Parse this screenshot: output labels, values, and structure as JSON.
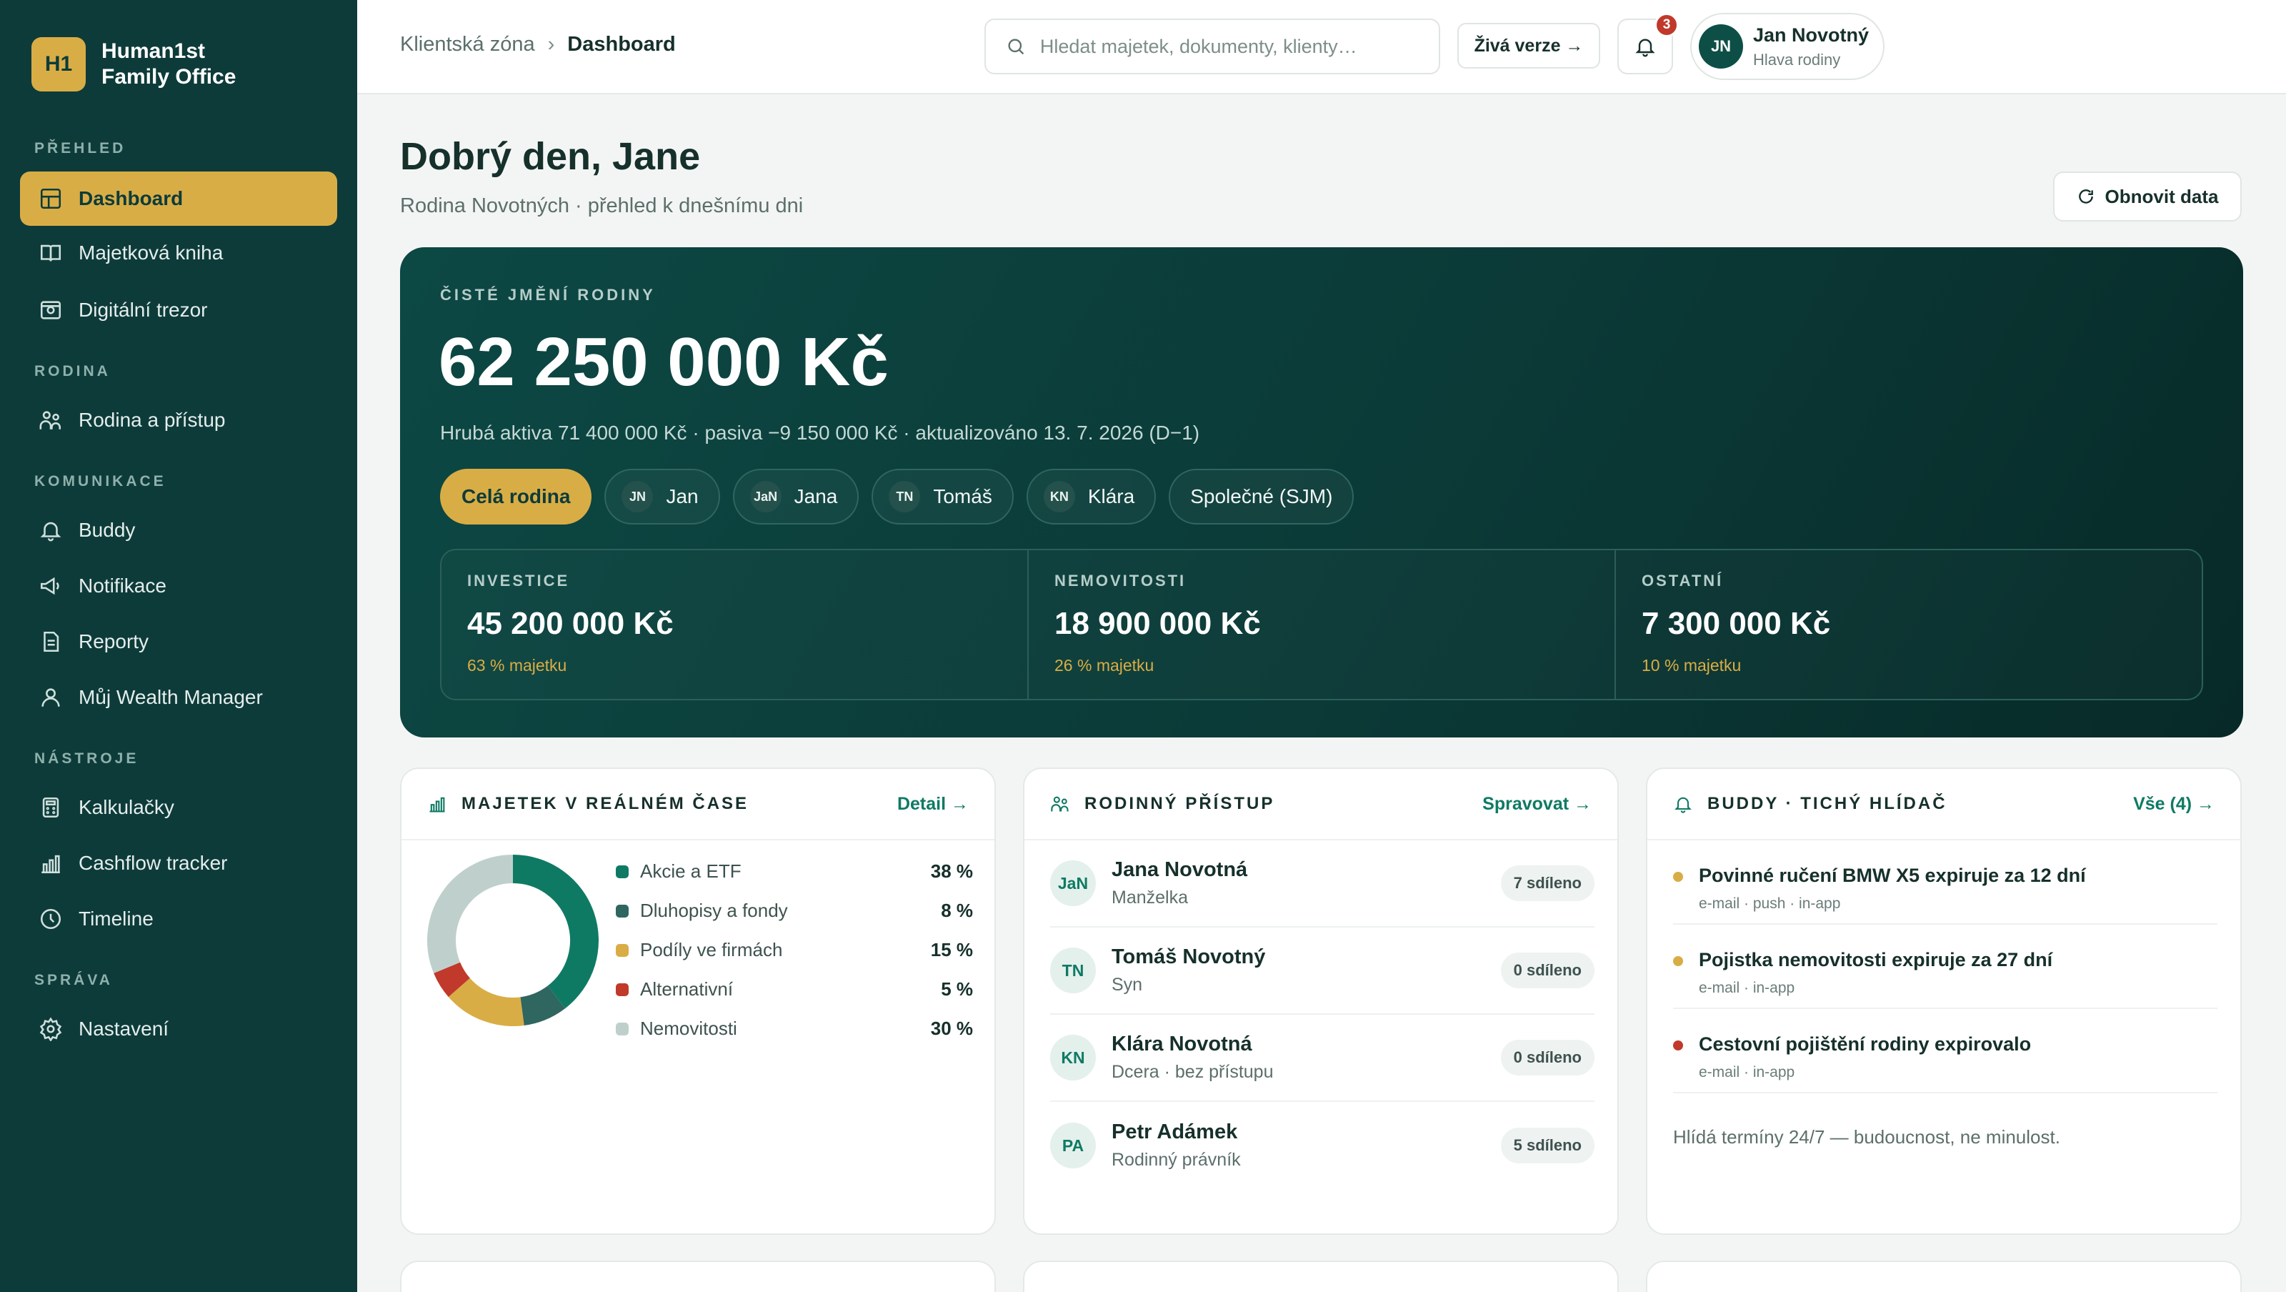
{
  "brand": {
    "logo": "H1",
    "name_line1": "Human1st",
    "name_line2": "Family Office"
  },
  "sidebar": {
    "sections": [
      {
        "title": "PŘEHLED",
        "items": [
          {
            "label": "Dashboard",
            "icon": "grid-icon",
            "active": true
          },
          {
            "label": "Majetková kniha",
            "icon": "book-icon"
          },
          {
            "label": "Digitální trezor",
            "icon": "safe-icon"
          }
        ]
      },
      {
        "title": "RODINA",
        "items": [
          {
            "label": "Rodina a přístup",
            "icon": "family-icon"
          }
        ]
      },
      {
        "title": "KOMUNIKACE",
        "items": [
          {
            "label": "Buddy",
            "icon": "bell-icon"
          },
          {
            "label": "Notifikace",
            "icon": "megaphone-icon"
          },
          {
            "label": "Reporty",
            "icon": "report-icon"
          },
          {
            "label": "Můj Wealth Manager",
            "icon": "user-icon"
          }
        ]
      },
      {
        "title": "NÁSTROJE",
        "items": [
          {
            "label": "Kalkulačky",
            "icon": "calculator-icon"
          },
          {
            "label": "Cashflow tracker",
            "icon": "chart-icon"
          },
          {
            "label": "Timeline",
            "icon": "clock-icon"
          }
        ]
      },
      {
        "title": "SPRÁVA",
        "items": [
          {
            "label": "Nastavení",
            "icon": "gear-icon"
          }
        ]
      }
    ]
  },
  "topbar": {
    "breadcrumb": {
      "root": "Klientská zóna",
      "separator": "›",
      "current": "Dashboard"
    },
    "search_placeholder": "Hledat majetek, dokumenty, klienty…",
    "live_label": "Živá verze →",
    "notification_count": "3",
    "user": {
      "initials": "JN",
      "name": "Jan Novotný",
      "role": "Hlava rodiny"
    }
  },
  "header": {
    "greeting": "Dobrý den, Jane",
    "subtitle": "Rodina Novotných · přehled k dnešnímu dni",
    "refresh_label": "Obnovit data"
  },
  "hero": {
    "label": "ČISTÉ JMĚNÍ RODINY",
    "value": "62 250 000 Kč",
    "sub": "Hrubá aktiva 71 400 000 Kč · pasiva −9 150 000 Kč · aktualizováno 13. 7. 2026 (D−1)",
    "chips": [
      {
        "label": "Celá rodina",
        "initials": "",
        "active": true
      },
      {
        "label": "Jan",
        "initials": "JN"
      },
      {
        "label": "Jana",
        "initials": "JaN"
      },
      {
        "label": "Tomáš",
        "initials": "TN"
      },
      {
        "label": "Klára",
        "initials": "KN"
      },
      {
        "label": "Společné (SJM)",
        "initials": ""
      }
    ],
    "stats": [
      {
        "label": "INVESTICE",
        "value": "45 200 000 Kč",
        "share": "63 % majetku"
      },
      {
        "label": "NEMOVITOSTI",
        "value": "18 900 000 Kč",
        "share": "26 % majetku"
      },
      {
        "label": "OSTATNÍ",
        "value": "7 300 000 Kč",
        "share": "10 % majetku"
      }
    ]
  },
  "assets_card": {
    "title": "MAJETEK V REÁLNÉM ČASE",
    "link": "Detail →",
    "legend": [
      {
        "label": "Akcie a ETF",
        "pct": "38 %",
        "color": "#0f7a64"
      },
      {
        "label": "Dluhopisy a fondy",
        "pct": "8 %",
        "color": "#2f6660"
      },
      {
        "label": "Podíly ve firmách",
        "pct": "15 %",
        "color": "#d9ad45"
      },
      {
        "label": "Alternativní",
        "pct": "5 %",
        "color": "#c0392b"
      },
      {
        "label": "Nemovitosti",
        "pct": "30 %",
        "color": "#bfd0cc"
      }
    ]
  },
  "chart_data": {
    "type": "pie",
    "categories": [
      "Akcie a ETF",
      "Dluhopisy a fondy",
      "Podíly ve firmách",
      "Alternativní",
      "Nemovitosti"
    ],
    "values": [
      38,
      8,
      15,
      5,
      30
    ],
    "colors": [
      "#0f7a64",
      "#2f6660",
      "#d9ad45",
      "#c0392b",
      "#bfd0cc"
    ],
    "title": "",
    "legend": "right"
  },
  "family_card": {
    "title": "RODINNÝ PŘÍSTUP",
    "link": "Spravovat →",
    "members": [
      {
        "initials": "JaN",
        "name": "Jana Novotná",
        "role": "Manželka",
        "shared": "7 sdíleno"
      },
      {
        "initials": "TN",
        "name": "Tomáš Novotný",
        "role": "Syn",
        "shared": "0 sdíleno"
      },
      {
        "initials": "KN",
        "name": "Klára Novotná",
        "role": "Dcera · bez přístupu",
        "shared": "0 sdíleno"
      },
      {
        "initials": "PA",
        "name": "Petr Adámek",
        "role": "Rodinný právník",
        "shared": "5 sdíleno"
      }
    ]
  },
  "buddy_card": {
    "title": "BUDDY · TICHÝ HLÍDAČ",
    "link": "Vše (4) →",
    "items": [
      {
        "title": "Povinné ručení BMW X5 expiruje za 12 dní",
        "meta": "e-mail · push · in-app",
        "color": "#d9ad45"
      },
      {
        "title": "Pojistka nemovitosti expiruje za 27 dní",
        "meta": "e-mail · in-app",
        "color": "#d9ad45"
      },
      {
        "title": "Cestovní pojištění rodiny expirovalo",
        "meta": "e-mail · in-app",
        "color": "#c0392b"
      }
    ],
    "footer": "Hlídá termíny 24/7 — budoucnost, ne minulost."
  }
}
